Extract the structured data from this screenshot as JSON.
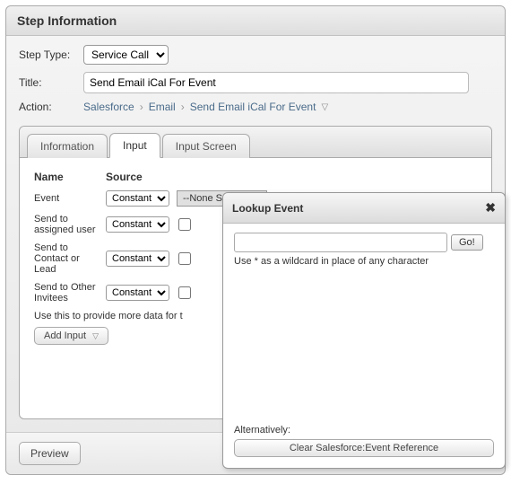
{
  "panel": {
    "title": "Step Information"
  },
  "form": {
    "stepTypeLabel": "Step Type:",
    "stepTypeValue": "Service Call",
    "titleLabel": "Title:",
    "titleValue": "Send Email iCal For Event",
    "actionLabel": "Action:",
    "breadcrumb": [
      "Salesforce",
      "Email",
      "Send Email iCal For Event"
    ]
  },
  "tabs": {
    "info": "Information",
    "input": "Input",
    "screen": "Input Screen"
  },
  "grid": {
    "headerName": "Name",
    "headerSource": "Source",
    "noneSelected": "--None Selected--",
    "constant": "Constant",
    "rows": [
      {
        "name": "Event"
      },
      {
        "name": "Send to assigned user"
      },
      {
        "name": "Send to Contact or Lead"
      },
      {
        "name": "Send to Other Invitees"
      }
    ],
    "hint": "Use this to provide more data for t",
    "addInput": "Add Input"
  },
  "footer": {
    "preview": "Preview"
  },
  "popup": {
    "title": "Lookup Event",
    "go": "Go!",
    "wildcard": "Use * as a wildcard in place of any character",
    "altLabel": "Alternatively:",
    "clear": "Clear Salesforce:Event Reference"
  }
}
